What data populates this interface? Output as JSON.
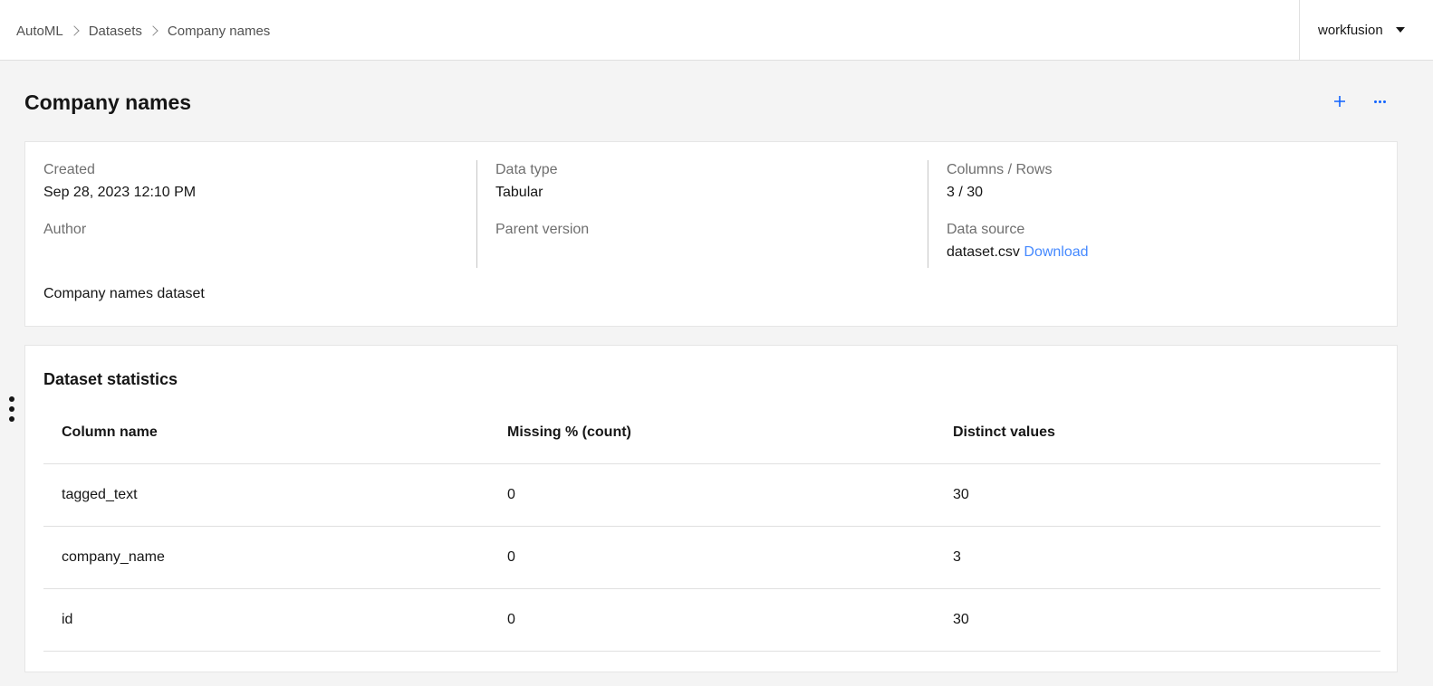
{
  "breadcrumb": {
    "items": [
      "AutoML",
      "Datasets",
      "Company names"
    ]
  },
  "user": {
    "name": "workfusion"
  },
  "header": {
    "title": "Company names",
    "add_icon": "plus-icon",
    "more_icon": "overflow-menu-icon",
    "accent_color": "#0f62fe"
  },
  "info": {
    "created_label": "Created",
    "created_value": "Sep 28, 2023 12:10 PM",
    "author_label": "Author",
    "data_type_label": "Data type",
    "data_type_value": "Tabular",
    "parent_version_label": "Parent version",
    "columns_rows_label": "Columns / Rows",
    "columns_rows_value": "3 / 30",
    "data_source_label": "Data source",
    "data_source_file": "dataset.csv",
    "download_label": "Download",
    "description": "Company names dataset"
  },
  "stats": {
    "title": "Dataset statistics",
    "columns": [
      "Column name",
      "Missing % (count)",
      "Distinct values"
    ],
    "rows": [
      [
        "tagged_text",
        "0",
        "30"
      ],
      [
        "company_name",
        "0",
        "3"
      ],
      [
        "id",
        "0",
        "30"
      ]
    ]
  }
}
